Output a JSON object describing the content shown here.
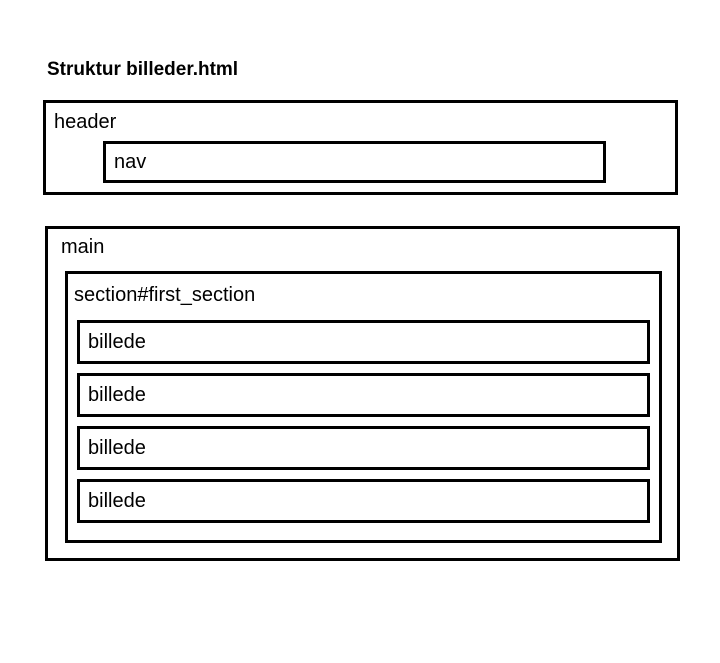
{
  "title": "Struktur billeder.html",
  "header": {
    "label": "header",
    "nav": {
      "label": "nav"
    }
  },
  "main": {
    "label": "main",
    "section": {
      "label": "section#first_section",
      "items": [
        {
          "label": "billede"
        },
        {
          "label": "billede"
        },
        {
          "label": "billede"
        },
        {
          "label": "billede"
        }
      ]
    }
  }
}
